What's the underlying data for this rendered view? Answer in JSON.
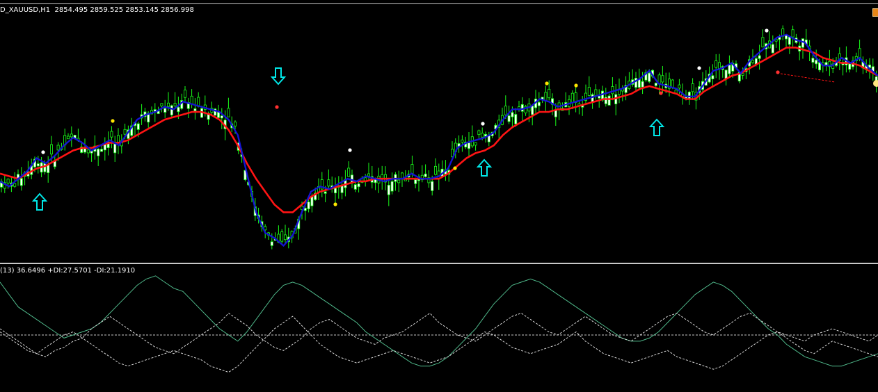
{
  "main_chart": {
    "header": "D_XAUUSD,H1  2854.495 2859.525 2853.145 2856.998",
    "colors": {
      "candle": "#19ff19",
      "fast_ma": "#1414d2",
      "slow_ma": "#ff1414",
      "arrow": "#00e8e8",
      "background": "#000000"
    }
  },
  "indicator": {
    "header": "(13) 36.6496 +DI:27.5701 -DI:21.1910",
    "colors": {
      "adx": "#4fb88a",
      "di_lines": "#d8d8d8",
      "level": "#c8c8c8"
    }
  },
  "chart_data": [
    {
      "type": "line",
      "series": [
        {
          "name": "",
          "color": "#1414d2",
          "y": [
            2842,
            2840,
            2843,
            2846,
            2851,
            2849,
            2852,
            2856,
            2859,
            2857,
            2854,
            2856,
            2858,
            2856,
            2861,
            2866,
            2868,
            2869,
            2871,
            2870,
            2873,
            2872,
            2871,
            2870,
            2869,
            2866,
            2860,
            2845,
            2830,
            2822,
            2820,
            2817,
            2821,
            2830,
            2838,
            2840,
            2839,
            2841,
            2843,
            2842,
            2844,
            2843,
            2842,
            2843,
            2843,
            2845,
            2843,
            2843,
            2844,
            2847,
            2855,
            2857,
            2858,
            2859,
            2861,
            2866,
            2870,
            2870,
            2871,
            2874,
            2873,
            2871,
            2872,
            2873,
            2874,
            2875,
            2876,
            2877,
            2878,
            2880,
            2882,
            2885,
            2880,
            2879,
            2878,
            2875,
            2875,
            2880,
            2885,
            2886,
            2888,
            2884,
            2889,
            2892,
            2895,
            2898,
            2899,
            2897,
            2896,
            2891,
            2887,
            2887,
            2890,
            2888,
            2890,
            2886,
            2883
          ]
        },
        {
          "name": "",
          "color": "#ff1414",
          "y": [
            2845,
            2844,
            2843,
            2845,
            2847,
            2848,
            2850,
            2852,
            2854,
            2855,
            2855,
            2856,
            2857,
            2857,
            2858,
            2860,
            2862,
            2864,
            2866,
            2867,
            2868,
            2869,
            2869,
            2868,
            2866,
            2862,
            2856,
            2849,
            2843,
            2838,
            2833,
            2830,
            2830,
            2833,
            2836,
            2838,
            2839,
            2840,
            2841,
            2842,
            2842,
            2843,
            2843,
            2843,
            2843,
            2843,
            2843,
            2843,
            2843,
            2845,
            2848,
            2851,
            2853,
            2854,
            2856,
            2860,
            2863,
            2865,
            2867,
            2869,
            2869,
            2870,
            2870,
            2871,
            2872,
            2873,
            2874,
            2874,
            2875,
            2876,
            2878,
            2879,
            2878,
            2877,
            2876,
            2874,
            2874,
            2877,
            2879,
            2881,
            2883,
            2884,
            2886,
            2888,
            2890,
            2892,
            2894,
            2894,
            2893,
            2892,
            2890,
            2889,
            2888,
            2888,
            2887,
            2885,
            2883
          ]
        }
      ],
      "ylim": [
        2812,
        2906
      ]
    },
    {
      "type": "line",
      "series": [
        {
          "name": "",
          "color": "#4fb88a",
          "y": [
            37,
            33,
            29,
            27,
            25,
            23,
            21,
            19,
            20,
            21,
            22,
            24,
            27,
            30,
            33,
            36,
            38,
            39,
            37,
            35,
            34,
            31,
            28,
            25,
            22,
            20,
            18,
            21,
            25,
            29,
            33,
            36,
            37,
            36,
            34,
            32,
            30,
            28,
            26,
            24,
            21,
            19,
            17,
            15,
            13,
            11,
            10,
            10,
            11,
            13,
            16,
            19,
            22,
            26,
            30,
            33,
            36,
            37,
            38,
            37,
            35,
            33,
            31,
            29,
            27,
            25,
            23,
            21,
            19,
            18,
            18,
            19,
            21,
            24,
            27,
            30,
            33,
            35,
            37,
            36,
            34,
            31,
            28,
            25,
            22,
            20,
            17,
            15,
            13,
            12,
            11,
            10,
            10,
            11,
            12,
            13,
            14
          ]
        },
        {
          "name": "",
          "color": "#d8d8d8",
          "y": [
            21,
            19,
            17,
            15,
            14,
            16,
            18,
            20,
            21,
            19,
            22,
            24,
            26,
            24,
            22,
            20,
            18,
            16,
            15,
            14,
            16,
            18,
            20,
            22,
            24,
            27,
            25,
            23,
            20,
            18,
            16,
            15,
            17,
            19,
            22,
            24,
            25,
            23,
            21,
            19,
            18,
            17,
            19,
            20,
            21,
            23,
            25,
            27,
            24,
            22,
            20,
            19,
            18,
            20,
            22,
            24,
            26,
            27,
            25,
            23,
            21,
            20,
            22,
            24,
            26,
            24,
            22,
            20,
            19,
            18,
            20,
            22,
            24,
            26,
            27,
            25,
            23,
            21,
            20,
            22,
            24,
            26,
            27,
            25,
            23,
            21,
            20,
            19,
            18,
            20,
            21,
            22,
            21,
            20,
            19,
            18,
            20
          ]
        },
        {
          "name": "",
          "color": "#d8d8d8",
          "y": [
            22,
            20,
            18,
            16,
            14,
            13,
            15,
            16,
            18,
            19,
            17,
            15,
            13,
            11,
            10,
            11,
            12,
            13,
            14,
            15,
            14,
            13,
            12,
            10,
            9,
            8,
            10,
            13,
            16,
            19,
            22,
            24,
            26,
            23,
            20,
            17,
            15,
            13,
            12,
            11,
            12,
            13,
            14,
            15,
            14,
            13,
            12,
            11,
            12,
            13,
            15,
            17,
            19,
            21,
            20,
            18,
            16,
            15,
            14,
            15,
            16,
            17,
            19,
            21,
            18,
            16,
            14,
            13,
            12,
            11,
            12,
            13,
            14,
            15,
            13,
            12,
            11,
            10,
            9,
            10,
            12,
            14,
            16,
            18,
            20,
            21,
            19,
            17,
            15,
            14,
            16,
            18,
            17,
            16,
            15,
            14,
            13
          ]
        },
        {
          "name": "",
          "color": "#c8c8c8",
          "y": [
            20
          ]
        }
      ],
      "ylim": [
        3,
        41
      ]
    }
  ]
}
